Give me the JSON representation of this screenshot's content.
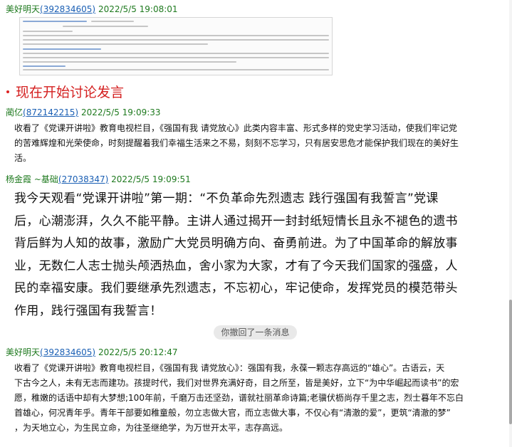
{
  "messages": [
    {
      "sender": "美好明天",
      "qq": "392834605",
      "time": "2022/5/5 19:08:01"
    },
    {
      "sender": "蔺亿",
      "qq": "872142215",
      "time": "2022/5/5 19:09:33",
      "lines": [
        "收看了《党课开讲啦》教育电视栏目，《强国有我 请党放心》此类内容丰富、形式多样的党史学习活动，使我们牢记党",
        "的苦难辉煌和光荣使命，时刻提醒着我们幸福生活来之不易，刻刻不忘学习，只有居安思危才能保护我们现在的美好生",
        "活。"
      ]
    },
    {
      "sender": "杨金霞 ~基础",
      "qq": "27038347",
      "time": "2022/5/5 19:09:51",
      "lines": [
        "我今天观看“党课开讲啦”第一期：“不负革命先烈遗志 践行强国有我誓言”党课",
        "后，心潮澎湃，久久不能平静。主讲人通过揭开一封封纸短情长且永不褪色的遗书",
        "背后鲜为人知的故事，激励广大党员明确方向、奋勇前进。为了中国革命的解放事",
        "业，无数仁人志士抛头颅洒热血，舍小家为大家，才有了今天我们国家的强盛，人",
        "民的幸福安康。我们要继承先烈遗志，不忘初心，牢记使命，发挥党员的模范带头",
        "作用，践行强国有我誓言！"
      ]
    },
    {
      "sender": "美好明天",
      "qq": "392834605",
      "time": "2022/5/5 20:12:47",
      "lines": [
        "收看了《党课开讲啦》教育电视栏目，《强国有我 请党放心》：强国有我，永葆一颗志存高远的“雄心”。古语云，天",
        "下古今之人，未有无志而建功。孩提时代，我们对世界充满好奇，目之所至，皆是美好，立下“为中华崛起而读书”的宏",
        "愿，稚嫩的话语中却有大梦想;100年前，千磨万击还坚劲，谱就社丽革命诗篇;老骥伏枥尚存千里之志，烈士暮年不忘白",
        "首雄心，何况青年乎。青年干部要如稚童般，勿立志做大官，而立志做大事，不仅心有“清澈的爱”，更筑“清澈的梦”",
        "，为天地立心，为生民立命，为往圣继绝学，为万世开太平，志存高远。"
      ]
    }
  ],
  "announcement": "现在开始讨论发言",
  "recall_notice": "你撤回了一条消息",
  "colors": {
    "sender": "#1f7a1f",
    "qq_link": "#1a5fb4",
    "announcement": "#d42020"
  }
}
